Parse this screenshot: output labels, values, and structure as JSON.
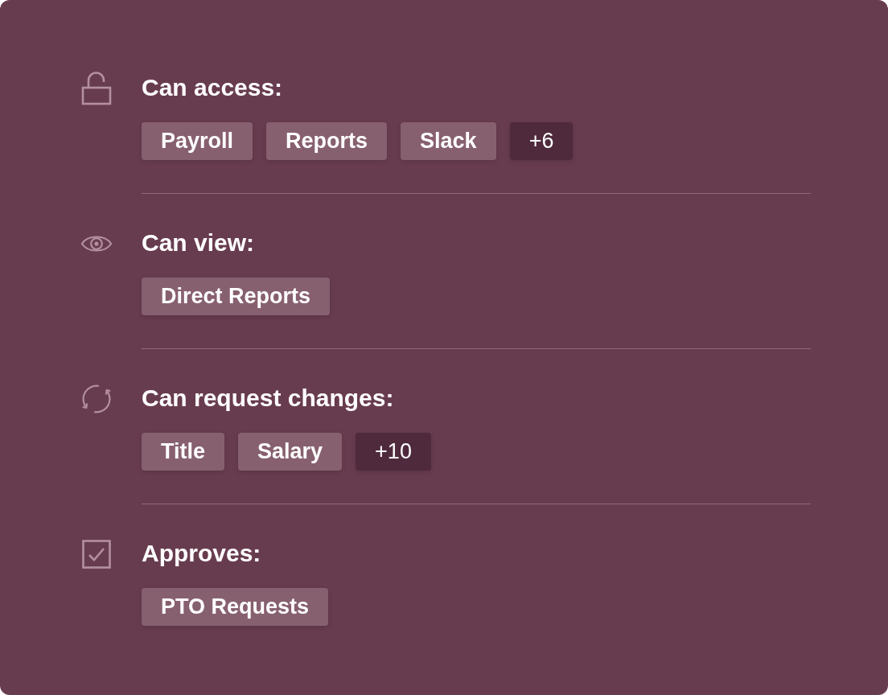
{
  "sections": [
    {
      "title": "Can access:",
      "tags": [
        {
          "label": "Payroll",
          "kind": "item"
        },
        {
          "label": "Reports",
          "kind": "item"
        },
        {
          "label": "Slack",
          "kind": "item"
        },
        {
          "label": "+6",
          "kind": "more"
        }
      ]
    },
    {
      "title": "Can view:",
      "tags": [
        {
          "label": "Direct Reports",
          "kind": "item"
        }
      ]
    },
    {
      "title": "Can request changes:",
      "tags": [
        {
          "label": "Title",
          "kind": "item"
        },
        {
          "label": "Salary",
          "kind": "item"
        },
        {
          "label": "+10",
          "kind": "more"
        }
      ]
    },
    {
      "title": "Approves:",
      "tags": [
        {
          "label": "PTO Requests",
          "kind": "item"
        }
      ]
    }
  ]
}
